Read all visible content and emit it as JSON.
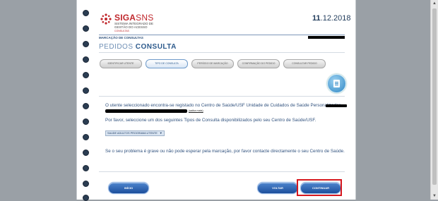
{
  "header": {
    "logo_title_bold": "SIGA",
    "logo_title_light": "SNS",
    "logo_subtitle": "SISTEMA INTEGRADO DE GESTÃO DO ACESSO",
    "logo_tagline": "CONSULTAS",
    "date_bold": "11",
    "date_rest": ".12.2018"
  },
  "breadcrumb": {
    "label": "MARCAÇÃO DE CONSULTAS"
  },
  "page_title": {
    "light": "PEDIDOS",
    "bold": "CONSULTA"
  },
  "steps": [
    {
      "label": "IDENTIFICAR UTENTE",
      "active": false
    },
    {
      "label": "TIPO DE CONSULTA",
      "active": true
    },
    {
      "label": "PERÍODO DE MARCAÇÃO",
      "active": false
    },
    {
      "label": "CONFIRMAÇÃO DO PEDIDO",
      "active": false
    },
    {
      "label": "CONSULTAR PEDIDO",
      "active": false
    }
  ],
  "content": {
    "line1": "O utente seleccionado encontra-se registado no Centro de Saúde/USF Unidade de Cuidados de Saúde Personalizados",
    "more_info_link": "(saiba mais)",
    "line2": "Por favor, seleccione um dos seguintes Tipos de Consulta disponibilizados pelo seu Centro de Saúde/USF.",
    "select_value": "SAUDE ADULTOS PROGRAMA UTENTE",
    "line3": "Se o seu problema é grave ou não pode esperar pela marcação, por favor contacte directamente o seu Centro de Saúde."
  },
  "buttons": {
    "start": "INÍCIO",
    "back": "VOLTAR",
    "continue": "CONTINUAR"
  },
  "colors": {
    "brand_red": "#c0282d",
    "text_blue": "#31527e",
    "button_blue": "#1c4f9c",
    "highlight_red": "#d6181f"
  }
}
